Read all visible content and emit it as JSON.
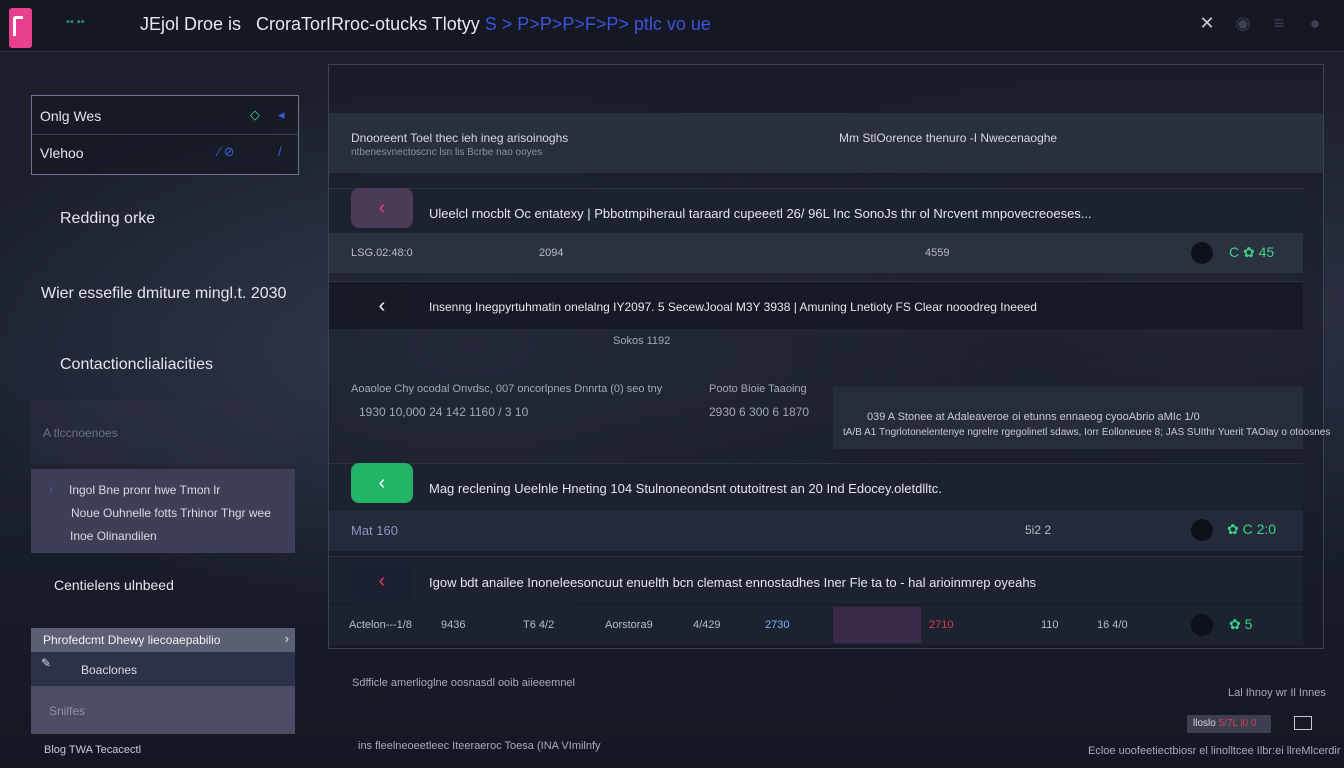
{
  "topbar": {
    "app_title": "JEjol Droe is",
    "title_rest": "CroraTorIRroc-otucks Tlotyy",
    "title_accent": "S > P>P>P>F>P> ptlc vo ue"
  },
  "sidebar": {
    "box_row1": "Onlg Wes",
    "box_row2": "Vlehoo",
    "items": [
      {
        "label": "Redding orke"
      },
      {
        "label": "Wier essefile dmiture mingl.t. 2030"
      },
      {
        "label": "Contactionclialiacities"
      },
      {
        "label": "A tlccnoenoes"
      }
    ],
    "card_lines": [
      "Ingol Bne pronr hwe Tmon lr",
      "Noue Ouhnelle fotts Trhinor Thgr wee",
      "Inoe Olinandilen"
    ],
    "item_centered": "Centielens ulnbeed",
    "selected_item": "Phrofedcmt Dhewy liecoaepabilio",
    "selected_sub": "Boaclones",
    "dim_item": "Snilfes",
    "footer": "Blog TWA Tecacectl"
  },
  "header": {
    "line1": "Dnooreent Toel thec ieh ineg arisoinoghs",
    "line2": "ntbenesvnectoscnc lsn lis Bcrbe nao ooyes",
    "right": "Mm  StlOorence thenuro  -I   Nwecenaoghe"
  },
  "rows": [
    {
      "text": "Uleelcl rnocblt Oc entatexy  |  Pbbotmpiheraul taraard cupeeetl  26/ 96L Inc  SonoJs thr ol Nrcvent mnpovecreoeses...",
      "stats": [
        "LSG.02:48:0",
        "2094",
        "4559"
      ],
      "icons": "C ✿ 45"
    },
    {
      "text": "Insenng Inegpyrtuhmatin onelalng IY2097. 5 SecewJooal M3Y 3938 | Amuning Lnetioty FS Clear nooodreg Ineeed",
      "sub": "Sokos  1192"
    },
    {
      "text": "Mag reclening Ueelnle Hneting 104  Stulnoneondsnt otutoitrest an   20   Ind Edocey.oletdlltc.",
      "stats": [
        "Mat 160",
        "5i2 2"
      ],
      "icons": "✿ C 2:0"
    },
    {
      "text": "Igow bdt anailee Inoneleesoncuut enuelth bcn clemast ennostadhes Iner Fle ta  to - hal arioinmrep oyeahs",
      "stats": [
        "Actelon---1/8",
        "9436",
        "T6 4/2",
        "Aorstora9",
        "4/429",
        "2730",
        "2710",
        "110",
        "16 4/0"
      ],
      "icons": "✿ 5"
    }
  ],
  "mid": {
    "line1": "Aoaoloe Chy ocodal Onvdsc, 007 oncorlpnes Dnnrta (0) seo tny",
    "line2": "1930  10,000    24 142  1160 / 3 10",
    "line3": "Pooto  Bioie  Taaoing",
    "line4": "2930  6 300 6  1870"
  },
  "alert": {
    "line1": "039 A Stonee at Adaleaveroe oi etunns  ennaeog cyooAbrio aMIc 1/0",
    "line2": "tA/B A1 Tngrlotonelentenye ngrelre rgegolinetl sdaws, Iorr Eolloneuee 8; JAS SUIthr Yuerit TAOiay o otoosnes"
  },
  "footer": {
    "line1": "Sdfficle amerlioglne oosnasdl ooib aiieeemnel",
    "line2": "ins fleelneoeetleec Iteeraeroc Toesa (INA VImilnfy",
    "right1": "Lal Ihnoy wr Il Innes",
    "right2": "Ecloe uoofeetiectbiosr el linolltcee Ilbr:ei llreMlcerdir (ee A",
    "chip1": "lloslo",
    "chip2": "5/7L i0 0"
  },
  "colors": {
    "accent_pink": "#e8408e",
    "accent_green": "#22b567",
    "accent_blue": "#3b55d9",
    "accent_red": "#d83a50"
  }
}
